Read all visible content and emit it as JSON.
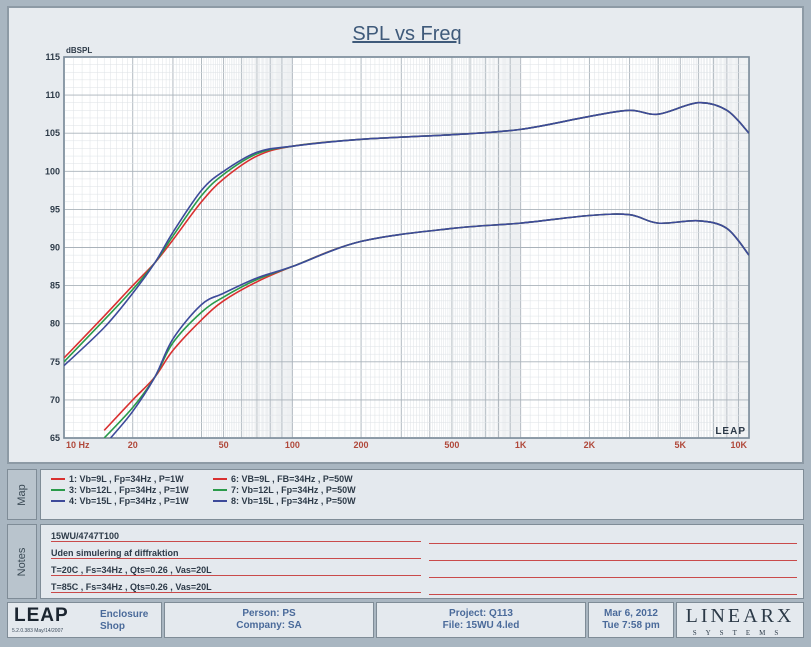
{
  "chart_data": {
    "type": "line",
    "title": "SPL vs Freq",
    "ylabel": "dBSPL",
    "xscale": "log",
    "xlim": [
      10,
      10000
    ],
    "ylim": [
      65,
      115
    ],
    "x_ticks": [
      "10 Hz",
      "20",
      "50",
      "100",
      "200",
      "500",
      "1K",
      "2K",
      "5K",
      "10K"
    ],
    "y_ticks": [
      "115",
      "110",
      "105",
      "100",
      "95",
      "90",
      "85",
      "80",
      "75",
      "70",
      "65"
    ],
    "grid": true,
    "watermark": "LEAP",
    "series": [
      {
        "name": "1: Vb=9L , Fp=34Hz , P=1W",
        "color": "#d93030",
        "x": [
          10,
          15,
          20,
          25,
          30,
          40,
          50,
          70,
          100,
          200,
          500,
          1000,
          2000,
          3000,
          4000,
          6000,
          8000,
          10000
        ],
        "y": [
          75.5,
          81,
          85,
          88,
          91,
          96,
          99,
          102,
          103.3,
          104.2,
          104.8,
          105.5,
          107.2,
          108,
          107.5,
          109,
          108,
          105
        ]
      },
      {
        "name": "3: Vb=12L , Fp=34Hz , P=1W",
        "color": "#2a9a4a",
        "x": [
          10,
          15,
          20,
          25,
          30,
          40,
          50,
          70,
          100,
          200,
          500,
          1000,
          2000,
          3000,
          4000,
          6000,
          8000,
          10000
        ],
        "y": [
          75,
          80.5,
          84.5,
          88,
          91.5,
          96.8,
          99.6,
          102.3,
          103.3,
          104.2,
          104.8,
          105.5,
          107.2,
          108,
          107.5,
          109,
          108,
          105
        ]
      },
      {
        "name": "4: Vb=15L , Fp=34Hz , P=1W",
        "color": "#3d4a9a",
        "x": [
          10,
          15,
          20,
          25,
          30,
          40,
          50,
          70,
          100,
          200,
          500,
          1000,
          2000,
          3000,
          4000,
          6000,
          8000,
          10000
        ],
        "y": [
          74.5,
          79.5,
          84,
          88,
          92,
          97.5,
          100,
          102.5,
          103.3,
          104.2,
          104.8,
          105.5,
          107.2,
          108,
          107.5,
          109,
          108,
          105
        ]
      },
      {
        "name": "6: VB=9L , FB=34Hz , P=50W",
        "color": "#d93030",
        "x": [
          15,
          20,
          25,
          30,
          40,
          50,
          70,
          100,
          200,
          500,
          1000,
          2000,
          3000,
          4000,
          6000,
          8000,
          10000
        ],
        "y": [
          66,
          70,
          73,
          76.5,
          80.5,
          83,
          85.5,
          87.5,
          90.8,
          92.5,
          93.2,
          94.2,
          94.3,
          93.2,
          93.5,
          92.5,
          89
        ]
      },
      {
        "name": "7: Vb=12L , Fp=34Hz , P=50W",
        "color": "#2a9a4a",
        "x": [
          15,
          20,
          25,
          30,
          40,
          50,
          70,
          100,
          200,
          500,
          1000,
          2000,
          3000,
          4000,
          6000,
          8000,
          10000
        ],
        "y": [
          65,
          69,
          73,
          77.5,
          81.5,
          83.5,
          85.8,
          87.5,
          90.8,
          92.5,
          93.2,
          94.2,
          94.3,
          93.2,
          93.5,
          92.5,
          89
        ]
      },
      {
        "name": "8: Vb=15L , Fp=34Hz , P=50W",
        "color": "#3d4a9a",
        "x": [
          16,
          20,
          25,
          30,
          40,
          50,
          70,
          100,
          200,
          500,
          1000,
          2000,
          3000,
          4000,
          6000,
          8000,
          10000
        ],
        "y": [
          65,
          68.5,
          73,
          78,
          82.5,
          84,
          86,
          87.5,
          90.8,
          92.5,
          93.2,
          94.2,
          94.3,
          93.2,
          93.5,
          92.5,
          89
        ]
      }
    ]
  },
  "side_tabs": {
    "map": "Map",
    "notes": "Notes"
  },
  "notes": [
    "15WU/4747T100",
    "Uden simulering af diffraktion",
    "T=20C , Fs=34Hz , Qts=0.26 , Vas=20L",
    "T=85C , Fs=34Hz , Qts=0.26 , Vas=20L"
  ],
  "footer": {
    "leap_logo": "LEAP",
    "leap_version": "5.2.0.383 May/14/2007",
    "product_line1": "Enclosure",
    "product_line2": "Shop",
    "person": "Person: PS",
    "company": "Company: SA",
    "project": "Project: Q113",
    "file": "File: 15WU 4.led",
    "date": "Mar  6, 2012",
    "time": "Tue  7:58 pm",
    "brand": "LINEARX",
    "brand_sub": "SYSTEMS"
  }
}
